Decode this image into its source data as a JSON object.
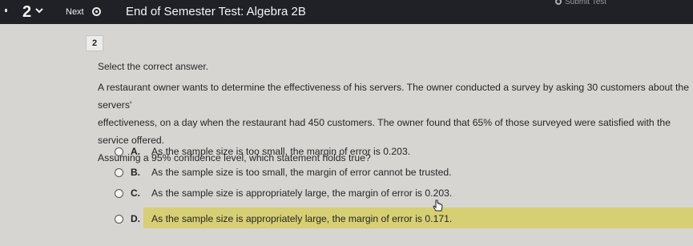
{
  "header": {
    "question_number": "2",
    "next_label": "Next",
    "title": "End of Semester Test: Algebra 2B",
    "submit_label": "Submit Test"
  },
  "question": {
    "number": "2",
    "instruction": "Select the correct answer.",
    "text_lines": [
      "A restaurant owner wants to determine the effectiveness of his servers. The owner conducted a survey by asking 30 customers about the servers'",
      "effectiveness, on a day when the restaurant had 450 customers. The owner found that 65% of those surveyed were satisfied with the service offered.",
      "Assuming a 95% confidence level, which statement holds true?"
    ],
    "options": [
      {
        "letter": "A.",
        "text": "As the sample size is too small, the margin of error is 0.203."
      },
      {
        "letter": "B.",
        "text": "As the sample size is too small, the margin of error cannot be trusted."
      },
      {
        "letter": "C.",
        "text": "As the sample size is appropriately large, the margin of error is 0.203."
      },
      {
        "letter": "D.",
        "text": "As the sample size is appropriately large, the margin of error is 0.171."
      }
    ],
    "selected_option": "D."
  },
  "colors": {
    "topbar": "#1f2126",
    "background": "#d6d5d2",
    "highlight": "#d7cf74"
  },
  "icons": [
    "chevron-down-icon",
    "next-arrow-icon",
    "submit-icon",
    "mouse-cursor-icon"
  ]
}
